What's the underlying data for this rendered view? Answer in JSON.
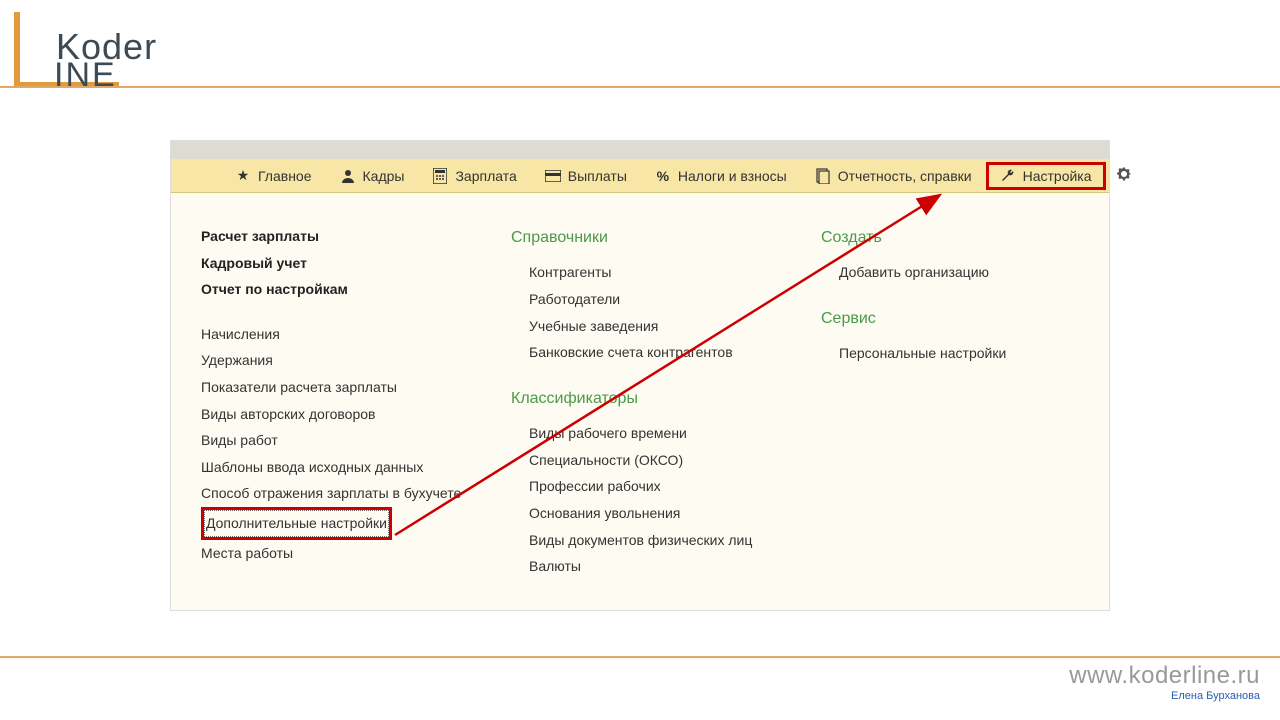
{
  "logo": {
    "line1": "Koder",
    "line2": "INE"
  },
  "toolbar": {
    "items": [
      {
        "icon": "hamburger-icon",
        "label": ""
      },
      {
        "icon": "star-icon",
        "label": "Главное"
      },
      {
        "icon": "person-icon",
        "label": "Кадры"
      },
      {
        "icon": "calc-icon",
        "label": "Зарплата"
      },
      {
        "icon": "card-icon",
        "label": "Выплаты"
      },
      {
        "icon": "percent-icon",
        "label": "Налоги и взносы"
      },
      {
        "icon": "doc-icon",
        "label": "Отчетность, справки"
      },
      {
        "icon": "wrench-icon",
        "label": "Настройка",
        "highlighted": true
      }
    ],
    "gear_visible": true
  },
  "column1": {
    "bold_items": [
      "Расчет зарплаты",
      "Кадровый учет",
      "Отчет по настройкам"
    ],
    "items": [
      "Начисления",
      "Удержания",
      "Показатели расчета зарплаты",
      "Виды авторских договоров",
      "Виды работ",
      "Шаблоны ввода исходных данных",
      "Способ отражения зарплаты в бухучете",
      "Дополнительные настройки",
      "Места работы"
    ],
    "highlighted_index": 7
  },
  "column2": {
    "sections": [
      {
        "title": "Справочники",
        "items": [
          "Контрагенты",
          "Работодатели",
          "Учебные заведения",
          "Банковские счета контрагентов"
        ]
      },
      {
        "title": "Классификаторы",
        "items": [
          "Виды рабочего времени",
          "Специальности (ОКСО)",
          "Профессии рабочих",
          "Основания увольнения",
          "Виды документов физических лиц",
          "Валюты"
        ]
      }
    ]
  },
  "column3": {
    "sections": [
      {
        "title": "Создать",
        "items": [
          "Добавить организацию"
        ]
      },
      {
        "title": "Сервис",
        "items": [
          "Персональные настройки"
        ]
      }
    ]
  },
  "footer": {
    "url": "www.koderline.ru",
    "author": "Елена Бурханова"
  }
}
